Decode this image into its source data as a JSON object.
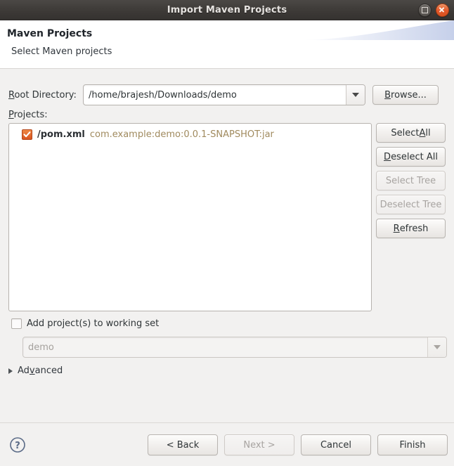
{
  "window": {
    "title": "Import Maven Projects",
    "maximize_icon": "maximize-icon",
    "close_icon": "close-icon"
  },
  "header": {
    "title": "Maven Projects",
    "subtitle": "Select Maven projects"
  },
  "form": {
    "root_directory": {
      "label_prefix": "R",
      "label_rest": "oot Directory:",
      "value": "/home/brajesh/Downloads/demo",
      "dropdown_icon": "chevron-down-icon"
    },
    "browse_button": {
      "prefix": "B",
      "rest": "rowse..."
    },
    "projects_label": {
      "prefix": "P",
      "rest": "rojects:"
    }
  },
  "projects": {
    "items": [
      {
        "checked": true,
        "name": "/pom.xml",
        "coordinates": "com.example:demo:0.0.1-SNAPSHOT:jar"
      }
    ]
  },
  "side_buttons": [
    {
      "prefix": "Select ",
      "accel": "A",
      "rest": "ll",
      "enabled": true
    },
    {
      "prefix": "",
      "accel": "D",
      "rest": "eselect All",
      "enabled": true
    },
    {
      "prefix": "Select Tree",
      "accel": "",
      "rest": "",
      "enabled": false
    },
    {
      "prefix": "Deselect Tree",
      "accel": "",
      "rest": "",
      "enabled": false
    },
    {
      "prefix": "",
      "accel": "R",
      "rest": "efresh",
      "enabled": true
    }
  ],
  "working_set": {
    "checkbox_label": "Add project(s) to working set",
    "checked": false,
    "combo_value": "demo",
    "combo_enabled": false,
    "dropdown_icon": "chevron-down-icon"
  },
  "advanced": {
    "label_prefix": "Ad",
    "label_accel": "v",
    "label_rest": "anced",
    "expander_icon": "triangle-right-icon",
    "expanded": false
  },
  "footer": {
    "help_icon": "help-question-icon",
    "buttons": [
      {
        "label": "< Back",
        "enabled": true
      },
      {
        "label": "Next >",
        "enabled": false
      },
      {
        "label": "Cancel",
        "enabled": true
      },
      {
        "label": "Finish",
        "enabled": true
      }
    ]
  },
  "colors": {
    "accent_orange": "#d9541f",
    "coords_text": "#a08a5e",
    "titlebar": "#3d3a37",
    "panel_bg": "#f2f1f0",
    "swoosh_blue": "#ccd5ec"
  }
}
